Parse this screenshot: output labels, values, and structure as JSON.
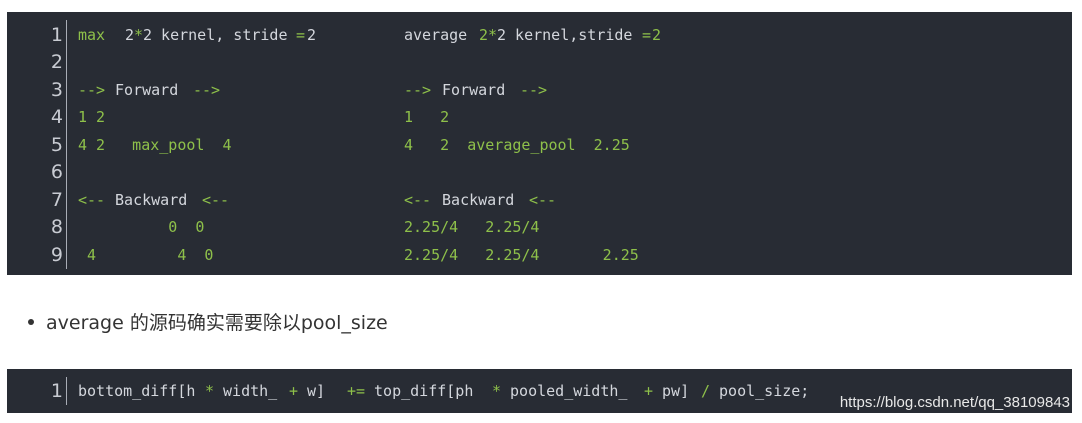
{
  "block1": {
    "line_numbers": [
      "1",
      "2",
      "3",
      "4",
      "5",
      "6",
      "7",
      "8",
      "9"
    ],
    "left": {
      "l1_kw": "max",
      "l1_a": "2",
      "l1_star": "*",
      "l1_b": "2 kernel, stride",
      "l1_eq": "=",
      "l1_c": "2",
      "l3_arrow1": "-->",
      "l3_text": " Forward ",
      "l3_arrow2": "-->",
      "l4": "1 2",
      "l5": "4 2   max_pool  4",
      "l7_arrow1": "<--",
      "l7_text": " Backward ",
      "l7_arrow2": "<--",
      "l8": "          0  0",
      "l9": " 4         4  0"
    },
    "right": {
      "l1_a": "average ",
      "l1_b": "2",
      "l1_star": "*",
      "l1_c": "2 kernel,stride",
      "l1_eq": "=",
      "l1_d": "2",
      "l3_arrow1": "-->",
      "l3_text": " Forward ",
      "l3_arrow2": "-->",
      "l4": "1   2",
      "l5": "4   2  average_pool  2.25",
      "l7_arrow1": "<--",
      "l7_text": " Backward ",
      "l7_arrow2": "<--",
      "l8": "2.25/4   2.25/4",
      "l9": "2.25/4   2.25/4       2.25"
    }
  },
  "bullet": {
    "text": "average 的源码确实需要除以pool_size"
  },
  "block2": {
    "line_number": "1",
    "p1": "bottom_diff[h ",
    "star1": "*",
    "p2": " width_ ",
    "plus1": "+",
    "p3": " w] ",
    "pluseq": "+=",
    "p4": " top_diff[ph ",
    "star2": "*",
    "p5": " pooled_width_ ",
    "plus2": "+",
    "p6": " pw] ",
    "slash": "/",
    "p7": " pool_size;"
  },
  "watermark": "https://blog.csdn.net/qq_38109843",
  "colors": {
    "code_bg": "#282c34",
    "code_text": "#d4d7dd",
    "operator_green": "#8ec04a"
  }
}
